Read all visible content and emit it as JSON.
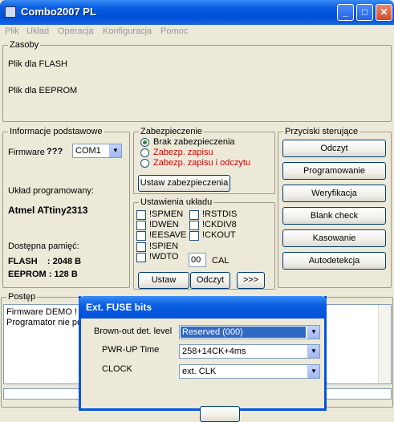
{
  "window": {
    "title": "Combo2007 PL"
  },
  "menu": [
    "Plik",
    "Układ",
    "Operacja",
    "Konfiguracja",
    "Pomoc"
  ],
  "zasoby": {
    "title": "Zasoby",
    "flash": "Plik dla FLASH",
    "eeprom": "Plik dla EEPROM"
  },
  "info": {
    "title": "Informacje podstawowe",
    "firmware_label": "Firmware",
    "firmware_value": "???",
    "port": "COM1",
    "uklad_label": "Układ programowany:",
    "uklad_value": "Atmel ATtiny2313",
    "pamiec_label": "Dostępna pamięć:",
    "flash": "FLASH    : 2048 B",
    "eeprom": "EEPROM : 128 B"
  },
  "zabezpieczenie": {
    "title": "Zabezpieczenie",
    "options": [
      "Brak zabezpieczenia",
      "Zabezp. zapisu",
      "Zabezp. zapisu i odczytu"
    ],
    "button": "Ustaw zabezpieczenia"
  },
  "ustawienia": {
    "title": "Ustawienia układu",
    "left": [
      "!SPMEN",
      "!DWEN",
      "!EESAVE",
      "!SPIEN",
      "!WDTO"
    ],
    "right": [
      "!RSTDIS",
      "!CKDIV8",
      "!CKOUT"
    ],
    "cal_value": "00",
    "cal_label": "CAL",
    "ustaw": "Ustaw",
    "odczyt": "Odczyt",
    "more": ">>>"
  },
  "przyciski": {
    "title": "Przyciski sterujące",
    "buttons": [
      "Odczyt",
      "Programowanie",
      "Weryfikacja",
      "Blank check",
      "Kasowanie",
      "Autodetekcja"
    ]
  },
  "postep": {
    "title": "Postęp",
    "lines": [
      "Firmware DEMO !",
      "Programator nie pod"
    ]
  },
  "dialog": {
    "title": "Ext. FUSE bits",
    "bod_label": "Brown-out det. level",
    "bod_value": "Reserved (000)",
    "pwr_label": "PWR-UP Time",
    "pwr_value": "258+14CK+4ms",
    "clock_label": "CLOCK",
    "clock_value": "ext. CLK"
  },
  "colors": {
    "titlebar": "#0a5ee0",
    "accent_red": "#d00000",
    "selection": "#316ac5"
  }
}
